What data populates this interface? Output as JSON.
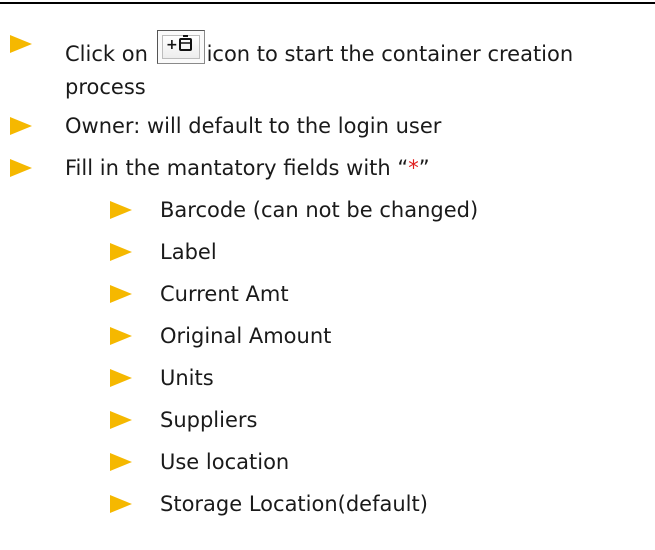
{
  "items": [
    {
      "prefix": "Click on ",
      "suffix": "icon to start the container creation",
      "continuation": "process",
      "icon": "add-container-icon"
    },
    {
      "text": "Owner: will default to the login user"
    },
    {
      "text_before": "Fill in the mantatory fields with “",
      "marker": "*",
      "text_after": "”"
    }
  ],
  "fields": [
    "Barcode (can not be changed)",
    "Label",
    "Current Amt",
    "Original Amount",
    "Units",
    "Suppliers",
    "Use location",
    "Storage Location(default)"
  ],
  "colors": {
    "bullet": "#f5b800",
    "required_marker": "#e02020",
    "text": "#1a1a1a"
  }
}
